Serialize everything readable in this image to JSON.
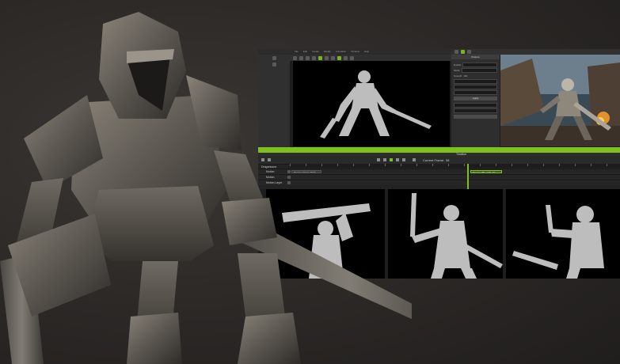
{
  "menubar": {
    "items": [
      "File",
      "Edit",
      "Create",
      "Modify",
      "Animation",
      "Window",
      "Help"
    ]
  },
  "properties": {
    "header": "Posture",
    "enable_label": "Enable",
    "mode_label": "Mode",
    "smooth_label": "Smooth",
    "value": "100",
    "button": "Apply"
  },
  "timeline": {
    "title": "Timeline",
    "current_frame_label": "Current Frame:",
    "current_frame": "36",
    "object_name": "Dragonbone",
    "tracks": [
      {
        "name": "Motion",
        "clips": [
          "Dragon_Flying_Walk",
          "Dragon_BK_walk_01"
        ]
      },
      {
        "name": "Motion",
        "clips": []
      },
      {
        "name": "Motion Layer",
        "clips": []
      }
    ]
  },
  "colors": {
    "accent": "#7fbf21",
    "silhouette": "#bdbdbd",
    "background": "#2b2826"
  }
}
